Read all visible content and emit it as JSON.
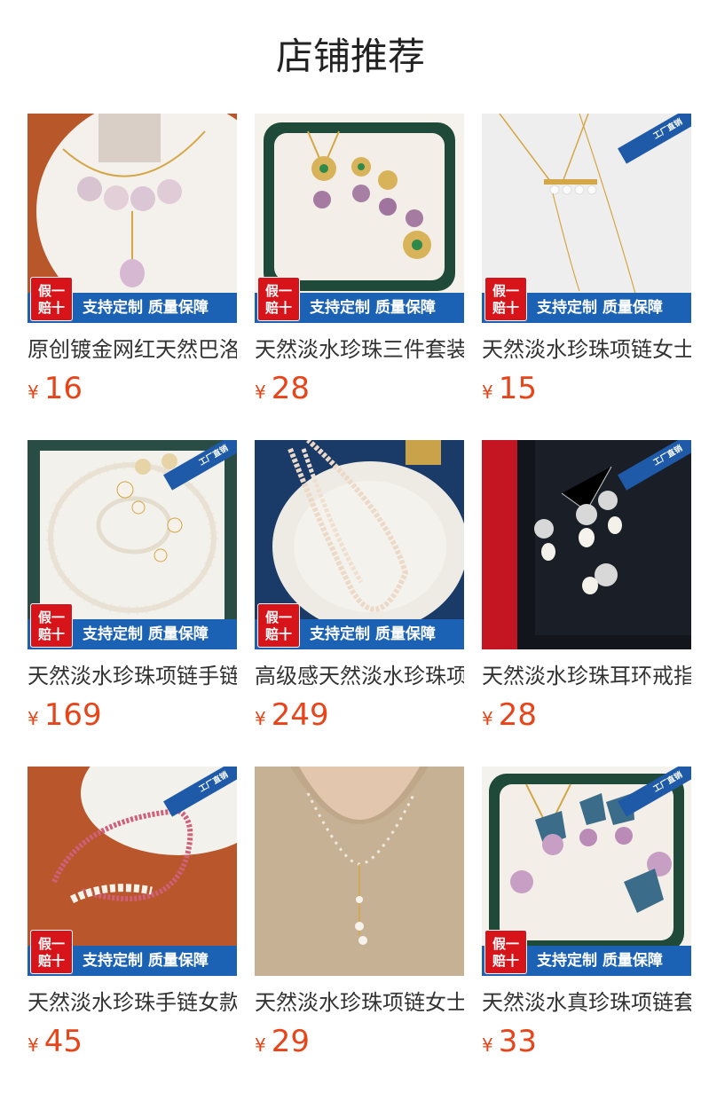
{
  "header": {
    "title": "店铺推荐"
  },
  "badges": {
    "corner": "工厂直销",
    "promo_tag_line1": "假一",
    "promo_tag_line2": "赔十",
    "promo_text": "支持定制 质量保障"
  },
  "currency": "¥",
  "products": [
    {
      "title": "原创镀金网红天然巴洛克",
      "price": "16"
    },
    {
      "title": "天然淡水珍珠三件套装",
      "price": "28"
    },
    {
      "title": "天然淡水珍珠项链女士",
      "price": "15"
    },
    {
      "title": "天然淡水珍珠项链手链",
      "price": "169"
    },
    {
      "title": "高级感天然淡水珍珠项链",
      "price": "249"
    },
    {
      "title": "天然淡水珍珠耳环戒指",
      "price": "28"
    },
    {
      "title": "天然淡水珍珠手链女款",
      "price": "45"
    },
    {
      "title": "天然淡水珍珠项链女士",
      "price": "29"
    },
    {
      "title": "天然淡水真珍珠项链套",
      "price": "33"
    }
  ],
  "colors": {
    "price": "#e8441a",
    "promo_bar": "#1c62b4",
    "promo_tag": "#d7141a"
  }
}
